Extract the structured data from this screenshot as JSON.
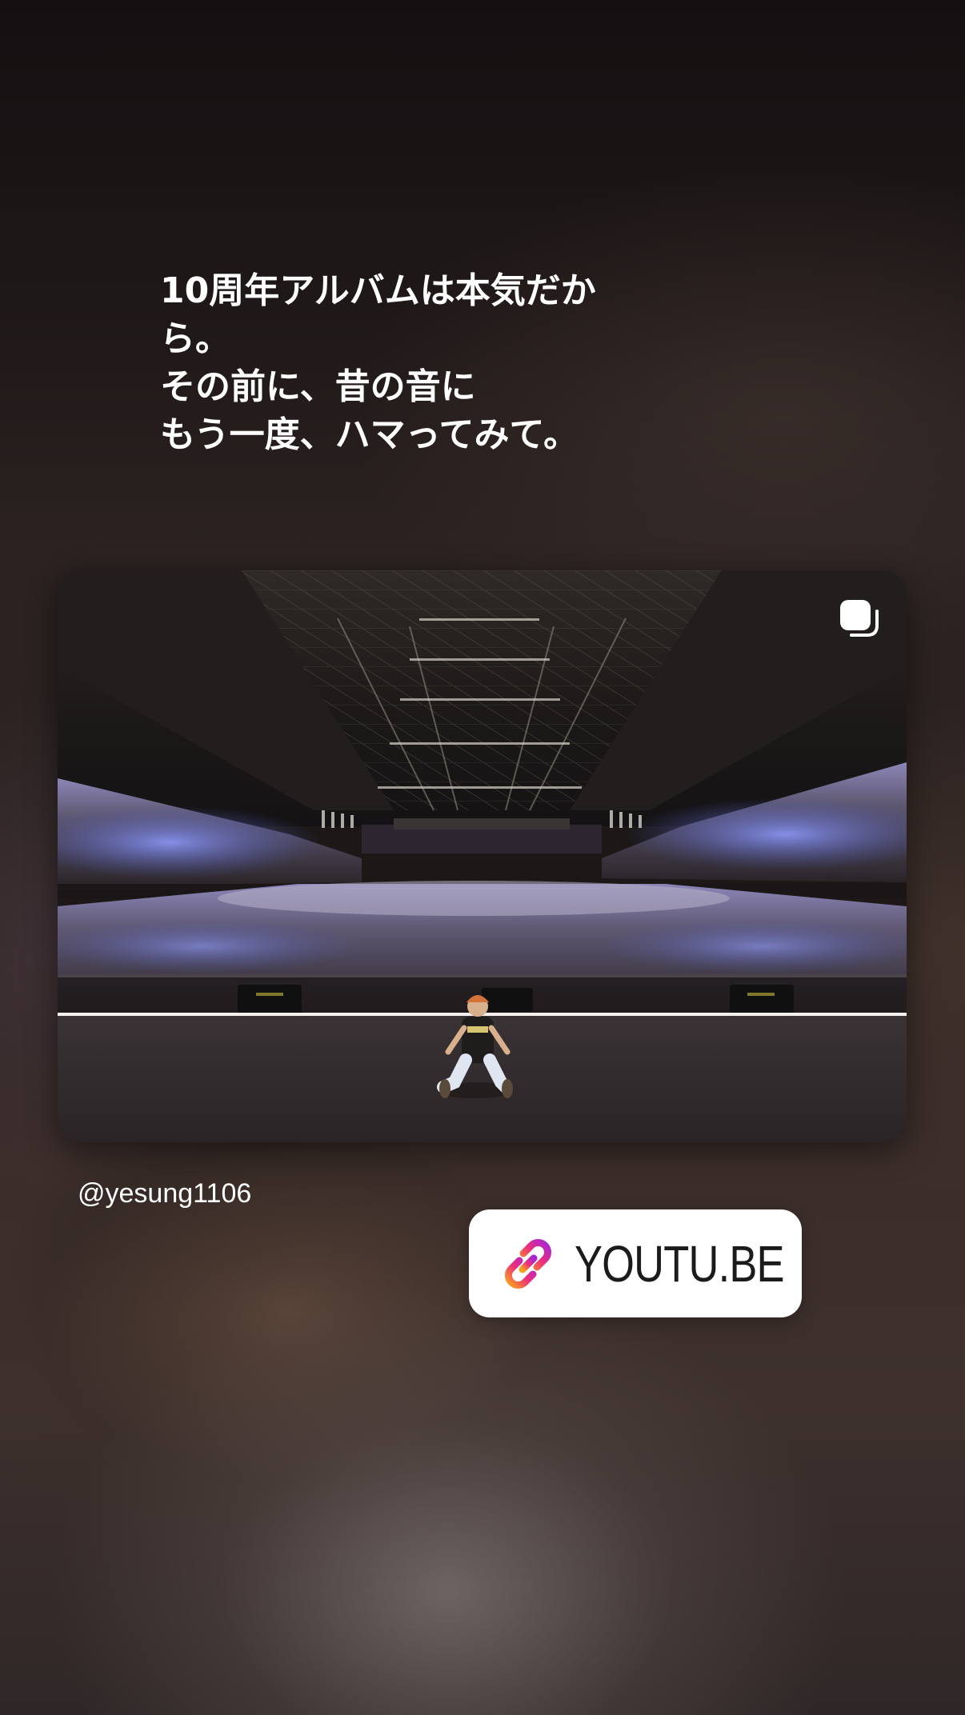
{
  "story": {
    "caption": "10周年アルバムは本気だか\nら。\nその前に、昔の音に\nもう一度、ハマってみて。",
    "photo_alt": "Arena concert photo with performer seated on stage",
    "multi_photo_icon": "carousel-icon",
    "handle": "@yesung1106",
    "link": {
      "icon": "link-icon",
      "label": "YOUTU.BE"
    }
  },
  "colors": {
    "crowd_light": "#7f8cff",
    "link_gradient_start": "#f7a21b",
    "link_gradient_mid": "#ec2e7b",
    "link_gradient_end": "#a626d6"
  }
}
